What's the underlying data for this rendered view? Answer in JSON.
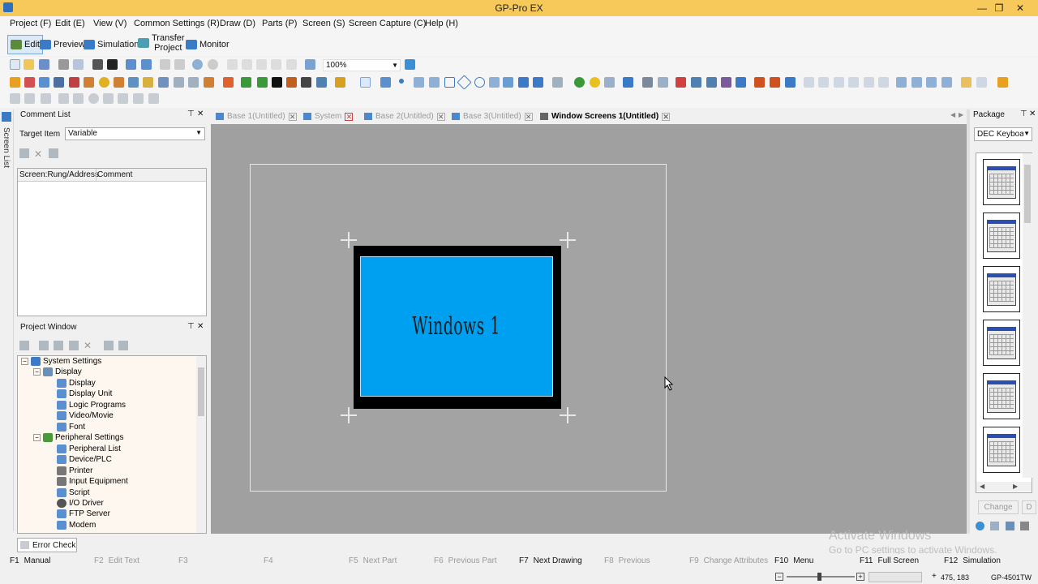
{
  "app": {
    "title": "GP-Pro EX"
  },
  "menu": [
    "Project (F)",
    "Edit (E)",
    "View (V)",
    "Common Settings (R)",
    "Draw (D)",
    "Parts (P)",
    "Screen (S)",
    "Screen Capture (C)",
    "Help (H)"
  ],
  "modes": {
    "edit": "Edit",
    "preview": "Preview",
    "simulation": "Simulation",
    "transfer_line1": "Transfer",
    "transfer_line2": "Project",
    "monitor": "Monitor"
  },
  "toolbar": {
    "zoom": "100%"
  },
  "screen_list_label": "Screen List",
  "comment_list": {
    "title": "Comment List",
    "target_label": "Target Item",
    "target_value": "Variable",
    "col1": "Screen:Rung/Address",
    "col2": "Comment"
  },
  "project_window": {
    "title": "Project Window",
    "tree": [
      "System Settings",
      "Display",
      "Display",
      "Display Unit",
      "Logic Programs",
      "Video/Movie",
      "Font",
      "Peripheral Settings",
      "Peripheral List",
      "Device/PLC",
      "Printer",
      "Input Equipment",
      "Script",
      "I/O Driver",
      "FTP Server",
      "Modem"
    ]
  },
  "error_check": "Error Check",
  "tabs": [
    {
      "label": "Base 1(Untitled)",
      "active": false
    },
    {
      "label": "System",
      "active": false
    },
    {
      "label": "Base 2(Untitled)",
      "active": false
    },
    {
      "label": "Base 3(Untitled)",
      "active": false
    },
    {
      "label": "Window Screens 1(Untitled)",
      "active": true
    }
  ],
  "canvas": {
    "window_label": "Windows 1",
    "window_color": "#00a0f0"
  },
  "package": {
    "title": "Package",
    "selection": "DEC Keyboar",
    "change": "Change",
    "d_button": "D"
  },
  "watermark": {
    "line1": "Activate Windows",
    "line2": "Go to PC settings to activate Windows."
  },
  "fkeys": [
    {
      "key": "F1",
      "label": "Manual",
      "enabled": true
    },
    {
      "key": "F2",
      "label": "Edit Text",
      "enabled": false
    },
    {
      "key": "F3",
      "label": "",
      "enabled": false
    },
    {
      "key": "F4",
      "label": "",
      "enabled": false
    },
    {
      "key": "F5",
      "label": "Next Part",
      "enabled": false
    },
    {
      "key": "F6",
      "label": "Previous Part",
      "enabled": false
    },
    {
      "key": "F7",
      "label": "Next Drawing",
      "enabled": true
    },
    {
      "key": "F8",
      "label": "Previous",
      "enabled": false
    },
    {
      "key": "F9",
      "label": "Change Attributes",
      "enabled": false
    },
    {
      "key": "F10",
      "label": "Menu",
      "enabled": true
    },
    {
      "key": "F11",
      "label": "Full Screen",
      "enabled": true
    },
    {
      "key": "F12",
      "label": "Simulation",
      "enabled": true
    }
  ],
  "status": {
    "coords": "475, 183",
    "model": "GP-4501TW"
  }
}
